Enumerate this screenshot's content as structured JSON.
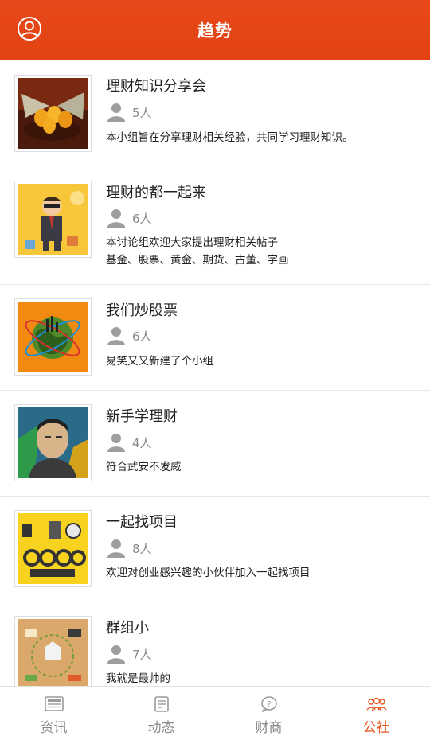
{
  "header": {
    "title": "趋势",
    "profile_icon": "user-circle-icon"
  },
  "groups": [
    {
      "name": "理财知识分享会",
      "members": "5人",
      "desc": [
        "本小组旨在分享理财相关经验，共同学习理财知识。"
      ]
    },
    {
      "name": "理财的都一起来",
      "members": "6人",
      "desc": [
        "本讨论组欢迎大家提出理财相关帖子",
        "基金、股票、黄金、期货、古董、字画"
      ]
    },
    {
      "name": "我们炒股票",
      "members": "6人",
      "desc": [
        "易笑又又新建了个小组"
      ]
    },
    {
      "name": "新手学理财",
      "members": "4人",
      "desc": [
        "符合武安不发威"
      ]
    },
    {
      "name": "一起找项目",
      "members": "8人",
      "desc": [
        "欢迎对创业感兴趣的小伙伴加入一起找项目"
      ]
    },
    {
      "name": "群组小",
      "members": "7人",
      "desc": [
        "我就是最帅的"
      ]
    }
  ],
  "tabs": [
    {
      "label": "资讯",
      "icon": "news-icon",
      "active": false
    },
    {
      "label": "动态",
      "icon": "feed-icon",
      "active": false
    },
    {
      "label": "财商",
      "icon": "question-bubble-icon",
      "active": false
    },
    {
      "label": "公社",
      "icon": "group-icon",
      "active": true
    }
  ],
  "colors": {
    "accent": "#e8481b",
    "active_tab": "#e8541e",
    "muted": "#8a8a8a"
  }
}
